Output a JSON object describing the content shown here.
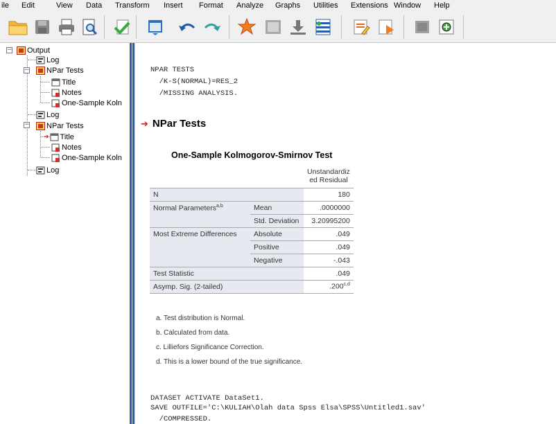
{
  "menu": [
    "File",
    "Edit",
    "View",
    "Data",
    "Transform",
    "Insert",
    "Format",
    "Analyze",
    "Graphs",
    "Utilities",
    "Extensions",
    "Window",
    "Help"
  ],
  "menu_display": [
    "ile",
    "Edit",
    "View",
    "Data",
    "Transform",
    "Insert",
    "Format",
    "Analyze",
    "Graphs",
    "Utilities",
    "Extensions",
    "Window",
    "Help"
  ],
  "toolbar": {
    "buttons": [
      "open-folder-icon",
      "save-icon",
      "print-icon",
      "print-preview-icon",
      "export-icon",
      "recall-dialog-icon",
      "undo-icon",
      "redo-icon",
      "goto-case-icon",
      "goto-variable-icon",
      "variables-icon",
      "designate-window-icon",
      "insert-text-icon",
      "script-icon",
      "hide-icon",
      "show-icon"
    ]
  },
  "outline": {
    "items": [
      {
        "label": "Output"
      },
      {
        "label": "Log"
      },
      {
        "label": "NPar Tests"
      },
      {
        "label": "Title"
      },
      {
        "label": "Notes"
      },
      {
        "label": "One-Sample Koln"
      },
      {
        "label": "Log"
      },
      {
        "label": "NPar Tests"
      },
      {
        "label": "Title"
      },
      {
        "label": "Notes"
      },
      {
        "label": "One-Sample Koln"
      },
      {
        "label": "Log"
      }
    ]
  },
  "syntax": {
    "line1": "NPAR TESTS",
    "line2": "  /K-S(NORMAL)=RES_2",
    "line3": "  /MISSING ANALYSIS.",
    "line4": "DATASET ACTIVATE DataSet1.",
    "line5": "SAVE OUTFILE='C:\\KULIAH\\Olah data Spss Elsa\\SPSS\\Untitled1.sav'",
    "line6": "  /COMPRESSED."
  },
  "section_title": "NPar Tests",
  "table": {
    "title": "One-Sample Kolmogorov-Smirnov Test",
    "column_header_line1": "Unstandardiz",
    "column_header_line2": "ed Residual",
    "rows": {
      "n_label": "N",
      "n_value": "180",
      "normal_params_label": "Normal Parameters",
      "normal_params_sup": "a,b",
      "mean_label": "Mean",
      "mean_value": ".0000000",
      "sd_label": "Std. Deviation",
      "sd_value": "3.20995200",
      "extreme_label": "Most Extreme Differences",
      "absolute_label": "Absolute",
      "absolute_value": ".049",
      "positive_label": "Positive",
      "positive_value": ".049",
      "negative_label": "Negative",
      "negative_value": "-.043",
      "test_stat_label": "Test Statistic",
      "test_stat_value": ".049",
      "asymp_label": "Asymp. Sig. (2-tailed)",
      "asymp_value": ".200",
      "asymp_sup": "c,d"
    },
    "footnotes": [
      "a. Test distribution is Normal.",
      "b. Calculated from data.",
      "c. Lilliefors Significance Correction.",
      "d. This is a lower bound of the true significance."
    ]
  }
}
